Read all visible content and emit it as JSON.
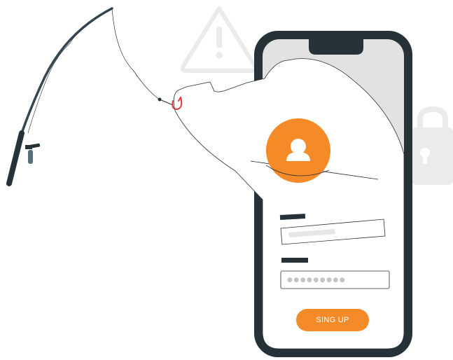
{
  "signup_button": {
    "label": "SING UP"
  },
  "password_field": {
    "mask": "●●●●●●●●●"
  },
  "icons": {
    "warning": "warning-triangle-icon",
    "lock": "padlock-icon",
    "user": "user-avatar-icon",
    "hook": "fishing-hook-icon",
    "rod": "fishing-rod-icon"
  },
  "colors": {
    "accent": "#F58A28",
    "phone_frame": "#263238",
    "hook": "#E0393E",
    "muted_icon": "#EBEBEB",
    "text_bar": "#263238"
  }
}
